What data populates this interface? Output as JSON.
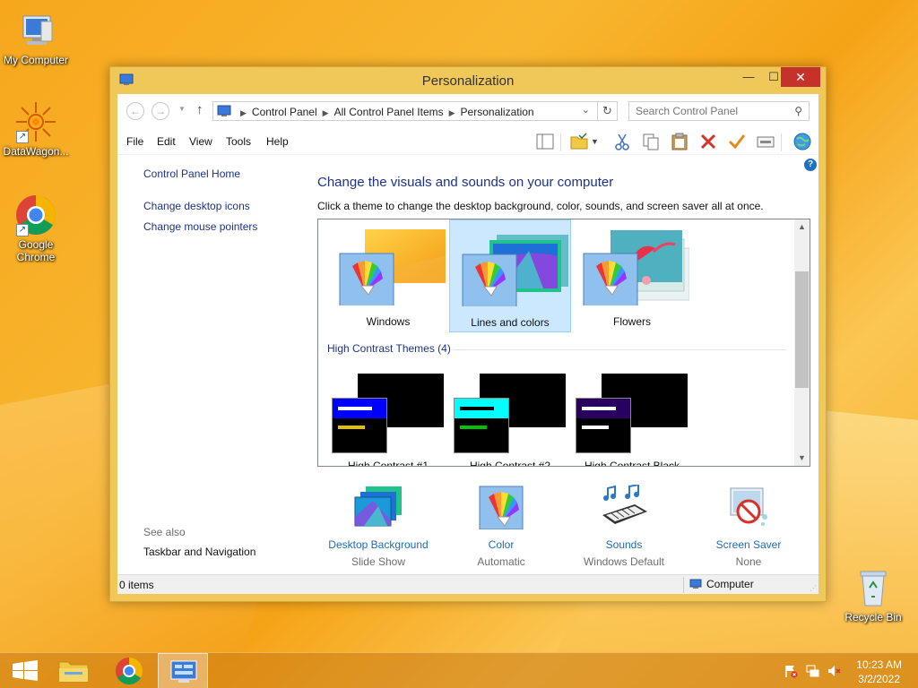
{
  "desktop": {
    "icons": [
      {
        "label": "My Computer"
      },
      {
        "label": "DataWagon..."
      },
      {
        "label": "Google Chrome"
      },
      {
        "label": "Recycle Bin"
      }
    ]
  },
  "window": {
    "title": "Personalization",
    "controls": {
      "minimize": "—",
      "maximize": "☐",
      "close": "✕"
    }
  },
  "navigation": {
    "back": "←",
    "forward": "→",
    "up": "↑",
    "breadcrumbs": [
      "Control Panel",
      "All Control Panel Items",
      "Personalization"
    ],
    "search_placeholder": "Search Control Panel"
  },
  "menu": [
    "File",
    "Edit",
    "View",
    "Tools",
    "Help"
  ],
  "left_pane": {
    "links": [
      "Control Panel Home",
      "Change desktop icons",
      "Change mouse pointers"
    ],
    "see_also_label": "See also",
    "see_also_links": [
      "Taskbar and Navigation"
    ]
  },
  "main": {
    "title": "Change the visuals and sounds on your computer",
    "subtitle": "Click a theme to change the desktop background, color, sounds, and screen saver all at once.",
    "themes": [
      {
        "label": "Windows",
        "selected": false
      },
      {
        "label": "Lines and colors",
        "selected": true
      },
      {
        "label": "Flowers",
        "selected": false
      }
    ],
    "high_contrast_header": "High Contrast Themes (4)",
    "high_contrast_themes": [
      {
        "label": "High Contrast #1",
        "title_color": "#0000ff",
        "line_color": "#ffffff",
        "line2_color": "#e0c000"
      },
      {
        "label": "High Contrast #2",
        "title_color": "#00ffff",
        "line_color": "#000000",
        "line2_color": "#00c000"
      },
      {
        "label": "High Contrast Black",
        "title_color": "#2a0060",
        "line_color": "#ffffff",
        "line2_color": "#ffffff"
      }
    ]
  },
  "settings": [
    {
      "name": "Desktop Background",
      "value": "Slide Show"
    },
    {
      "name": "Color",
      "value": "Automatic"
    },
    {
      "name": "Sounds",
      "value": "Windows Default"
    },
    {
      "name": "Screen Saver",
      "value": "None"
    }
  ],
  "status": {
    "items": "0 items",
    "location": "Computer"
  },
  "taskbar": {
    "start": "start-icon",
    "time": "10:23 AM",
    "date": "3/2/2022"
  },
  "colors": {
    "link": "#1e3287",
    "selection": "#cce8ff",
    "close_button": "#c7312b",
    "window_frame": "#f0c85a"
  }
}
